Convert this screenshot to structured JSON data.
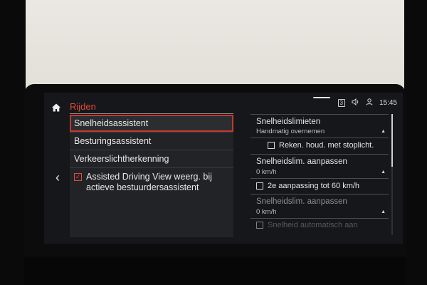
{
  "header": {
    "title": "Rijden"
  },
  "status": {
    "badge": "3",
    "time": "15:45"
  },
  "menu": {
    "items": [
      {
        "label": "Snelheidsassistent"
      },
      {
        "label": "Besturingsassistent"
      },
      {
        "label": "Verkeerslichtherkenning"
      }
    ],
    "check_item": {
      "line1": "Assisted Driving View weerg. bij",
      "line2": "actieve bestuurdersassistent",
      "checked": true
    }
  },
  "detail": {
    "speed_limits": {
      "title": "Snelheidslimieten",
      "value": "Handmatig overnemen"
    },
    "stoplight_option": {
      "label": "Reken. houd. met stoplicht.",
      "checked": false
    },
    "adjust1": {
      "title": "Snelheidslim. aanpassen",
      "value": "0 km/h"
    },
    "second_adjust": {
      "label": "2e aanpassing tot 60 km/h",
      "checked": false
    },
    "adjust2": {
      "title": "Snelheidslim. aanpassen",
      "value": "0 km/h"
    },
    "auto_option": {
      "label": "Snelheid automatisch aan"
    }
  },
  "colors": {
    "accent": "#e24a3d",
    "screen_bg": "#16171a"
  },
  "icons": {
    "home": "home-icon",
    "back": "chevron-left-icon",
    "volume": "volume-icon",
    "user": "user-icon",
    "check": "check-icon",
    "dropdown": "caret-icon"
  }
}
